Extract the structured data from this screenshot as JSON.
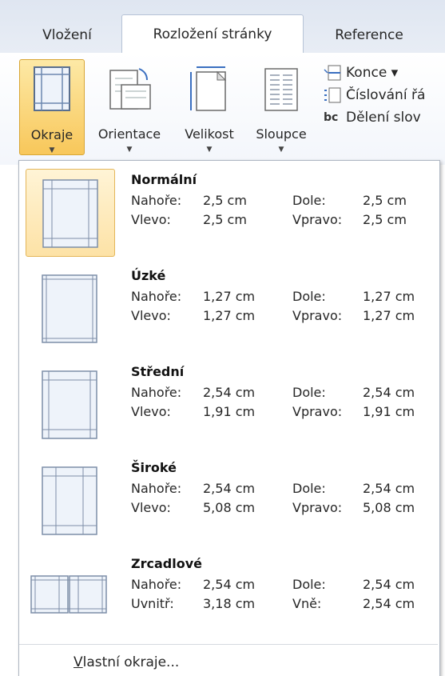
{
  "tabs": [
    {
      "label": "Vložení",
      "active": false
    },
    {
      "label": "Rozložení stránky",
      "active": true
    },
    {
      "label": "Reference",
      "active": false
    }
  ],
  "ribbon": {
    "buttons": [
      {
        "label": "Okraje",
        "active": true,
        "icon": "margins-icon"
      },
      {
        "label": "Orientace",
        "active": false,
        "icon": "orientation-icon"
      },
      {
        "label": "Velikost",
        "active": false,
        "icon": "size-icon"
      },
      {
        "label": "Sloupce",
        "active": false,
        "icon": "columns-icon"
      }
    ],
    "small": [
      {
        "label": "Konce ▾",
        "icon": "breaks-icon"
      },
      {
        "label": "Číslování řá",
        "icon": "line-numbers-icon"
      },
      {
        "label": "Dělení slov",
        "icon": "hyphenation-icon"
      }
    ],
    "hyphen_glyph": "bc"
  },
  "margins": [
    {
      "name": "Normální",
      "selected": true,
      "row1": {
        "l1": "Nahoře:",
        "v1": "2,5 cm",
        "l2": "Dole:",
        "v2": "2,5 cm"
      },
      "row2": {
        "l1": "Vlevo:",
        "v1": "2,5 cm",
        "l2": "Vpravo:",
        "v2": "2,5 cm"
      }
    },
    {
      "name": "Úzké",
      "selected": false,
      "row1": {
        "l1": "Nahoře:",
        "v1": "1,27 cm",
        "l2": "Dole:",
        "v2": "1,27 cm"
      },
      "row2": {
        "l1": "Vlevo:",
        "v1": "1,27 cm",
        "l2": "Vpravo:",
        "v2": "1,27 cm"
      }
    },
    {
      "name": "Střední",
      "selected": false,
      "row1": {
        "l1": "Nahoře:",
        "v1": "2,54 cm",
        "l2": "Dole:",
        "v2": "2,54 cm"
      },
      "row2": {
        "l1": "Vlevo:",
        "v1": "1,91 cm",
        "l2": "Vpravo:",
        "v2": "1,91 cm"
      }
    },
    {
      "name": "Široké",
      "selected": false,
      "row1": {
        "l1": "Nahoře:",
        "v1": "2,54 cm",
        "l2": "Dole:",
        "v2": "2,54 cm"
      },
      "row2": {
        "l1": "Vlevo:",
        "v1": "5,08 cm",
        "l2": "Vpravo:",
        "v2": "5,08 cm"
      }
    },
    {
      "name": "Zrcadlové",
      "selected": false,
      "row1": {
        "l1": "Nahoře:",
        "v1": "2,54 cm",
        "l2": "Dole:",
        "v2": "2,54 cm"
      },
      "row2": {
        "l1": "Uvnitř:",
        "v1": "3,18 cm",
        "l2": "Vně:",
        "v2": "2,54 cm"
      }
    }
  ],
  "footer": {
    "accel": "V",
    "rest": "lastní okraje..."
  },
  "colors": {
    "accent": "#f8c75a",
    "selected_bg": "#fde2a6"
  }
}
